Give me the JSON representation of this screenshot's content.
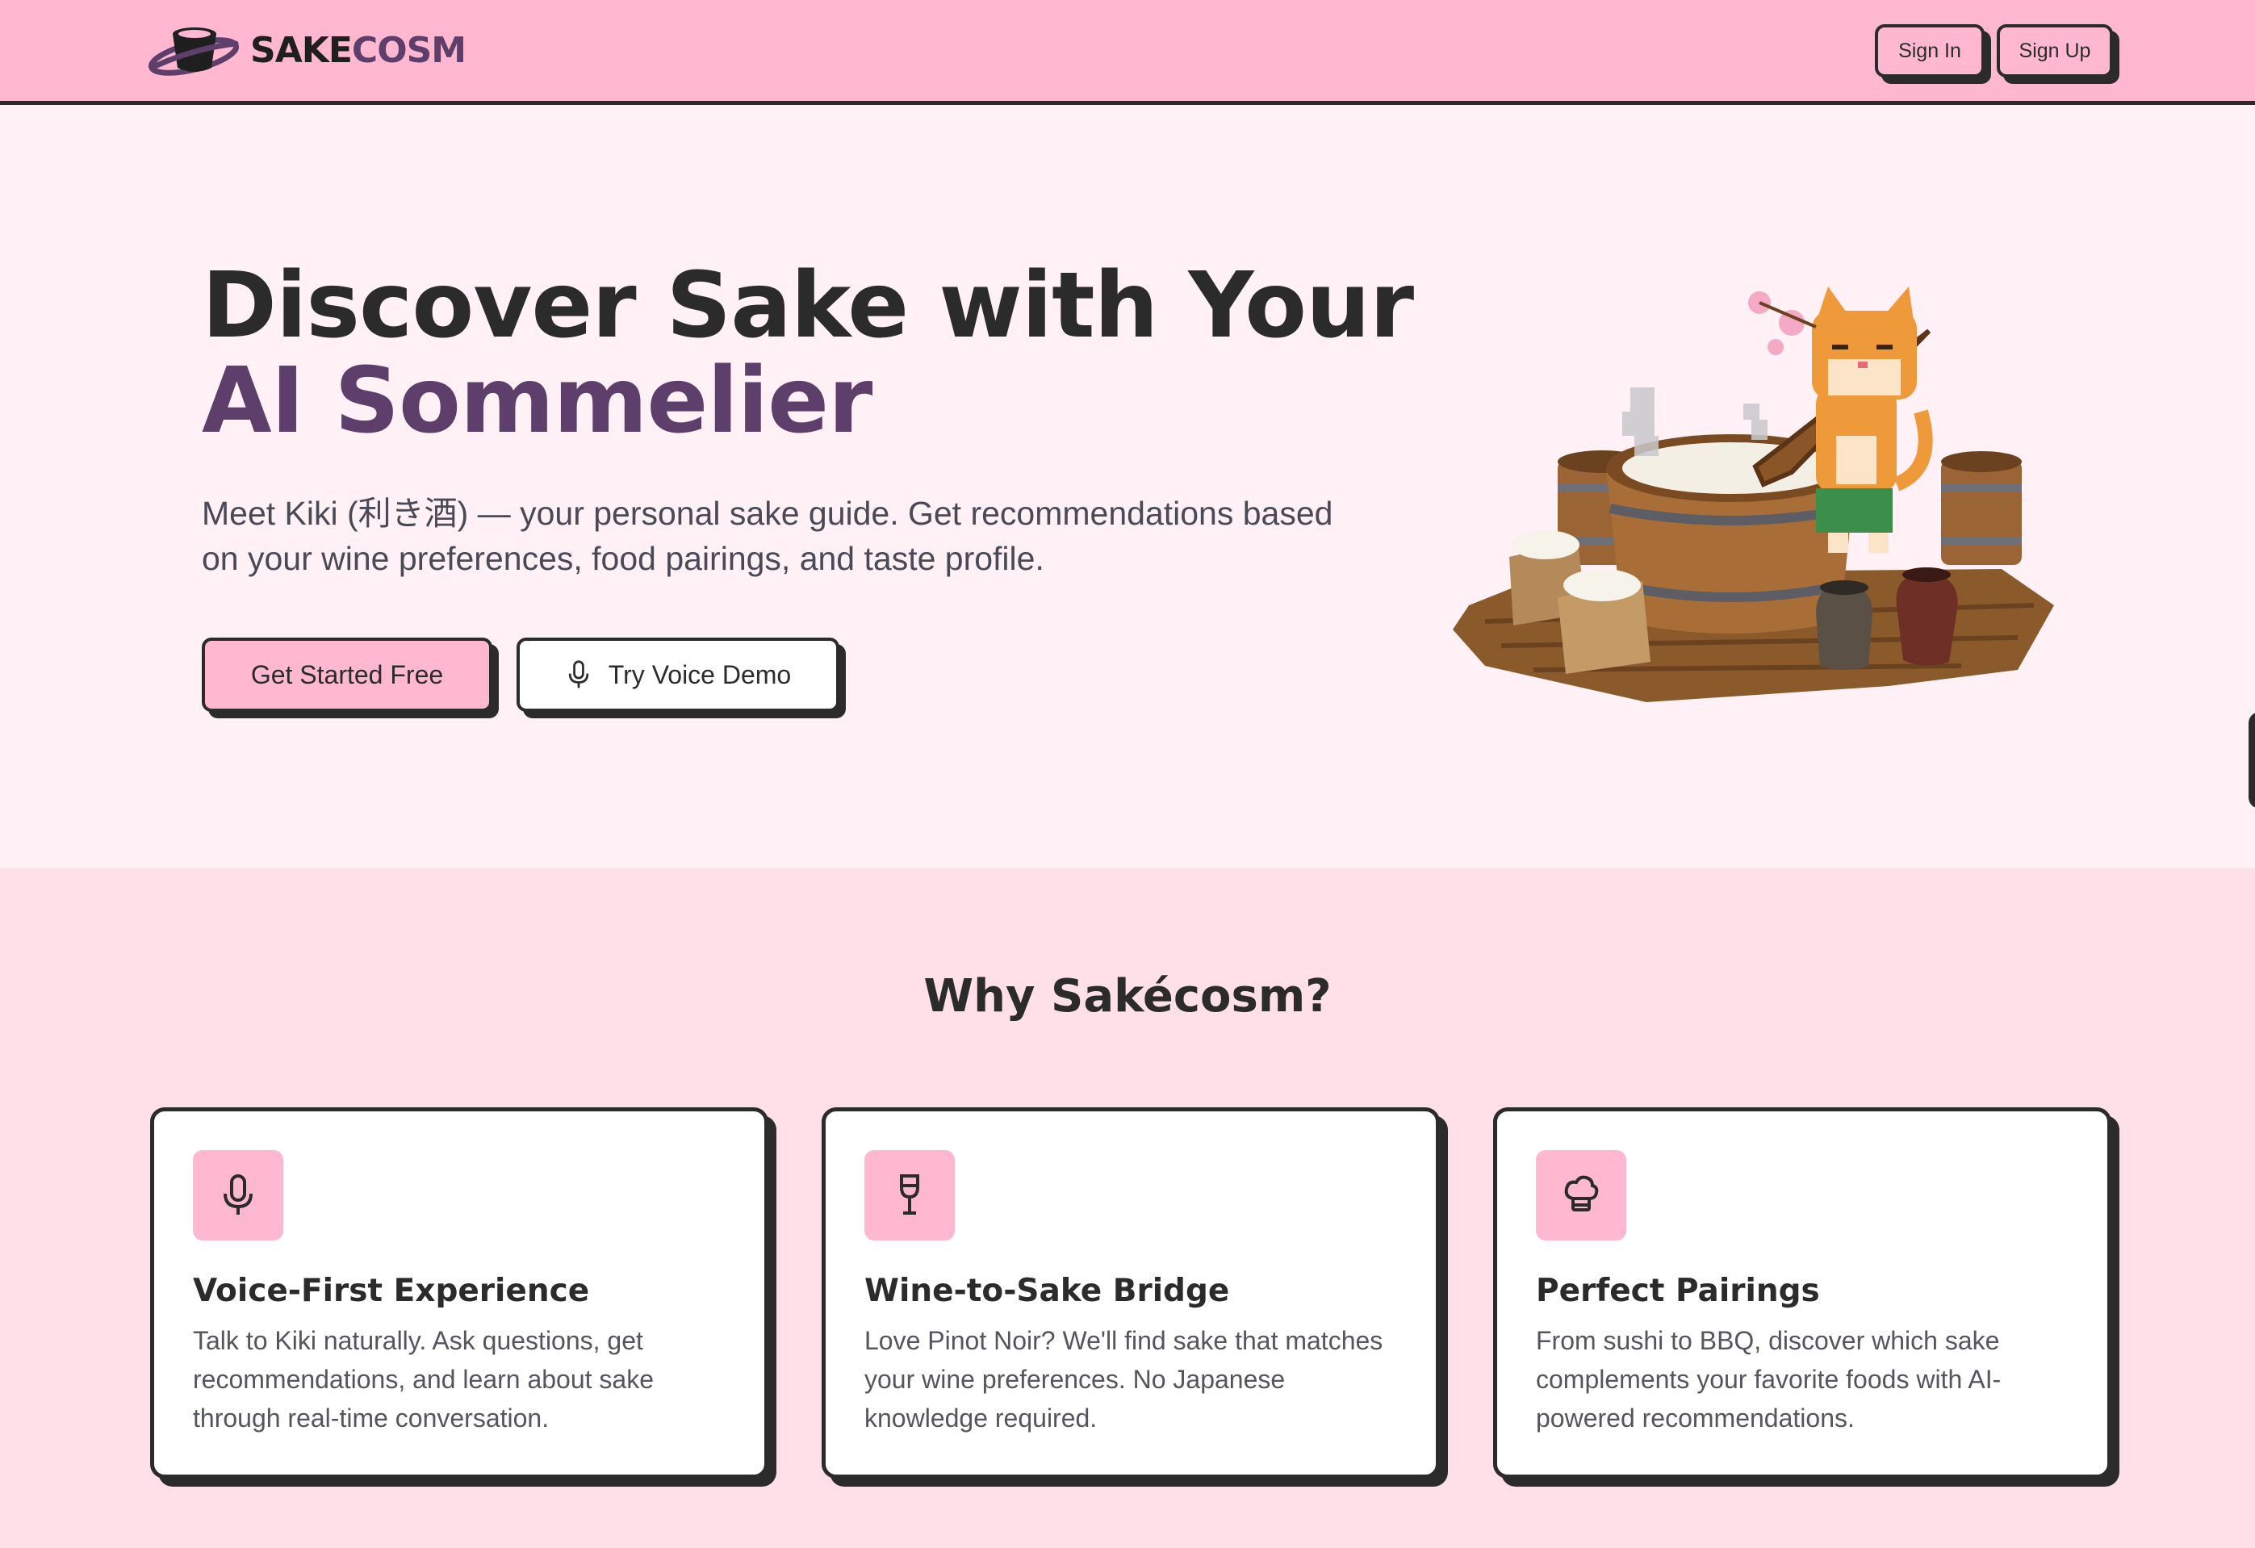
{
  "brand": {
    "name_dark": "SAKE",
    "name_accent": "COSM"
  },
  "header": {
    "sign_in": "Sign In",
    "sign_up": "Sign Up"
  },
  "hero": {
    "title_line1": "Discover Sake with Your",
    "title_line2": "AI Sommelier",
    "lead": "Meet Kiki (利き酒) — your personal sake guide. Get recommendations based on your wine preferences, food pairings, and taste profile.",
    "primary_cta": "Get Started Free",
    "secondary_cta": "Try Voice Demo"
  },
  "features": {
    "title": "Why Sakécosm?",
    "cards": [
      {
        "icon": "microphone-icon",
        "title": "Voice-First Experience",
        "desc": "Talk to Kiki naturally. Ask questions, get recommendations, and learn about sake through real-time conversation."
      },
      {
        "icon": "wine-glass-icon",
        "title": "Wine-to-Sake Bridge",
        "desc": "Love Pinot Noir? We'll find sake that matches your wine preferences. No Japanese knowledge required."
      },
      {
        "icon": "chef-hat-icon",
        "title": "Perfect Pairings",
        "desc": "From sushi to BBQ, discover which sake complements your favorite foods with AI-powered recommendations."
      }
    ]
  },
  "colors": {
    "header_bg": "#ffb8cf",
    "hero_bg": "#fff1f5",
    "section_bg": "#ffe0e9",
    "accent_purple": "#5e3f6b",
    "ink": "#2b2b2b"
  }
}
